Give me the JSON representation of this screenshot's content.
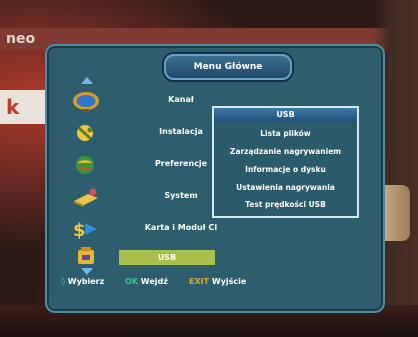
{
  "background": {
    "ticker_text": "neo",
    "side_letter": "k"
  },
  "menu": {
    "title": "Menu Główne",
    "items": [
      {
        "label": "Kanał",
        "icon": "tv-icon"
      },
      {
        "label": "Instalacja",
        "icon": "satellite-dish-icon"
      },
      {
        "label": "Preferencje",
        "icon": "globe-icon"
      },
      {
        "label": "System",
        "icon": "system-icon"
      },
      {
        "label": "Karta i Moduł CI",
        "icon": "card-icon"
      },
      {
        "label": "USB",
        "icon": "usb-icon",
        "selected": true
      }
    ]
  },
  "usb_panel": {
    "title": "USB",
    "items": [
      "Lista plików",
      "Zarządzanie nagrywaniem",
      "Informacje o dysku",
      "Ustawienia nagrywania",
      "Test prędkości USB"
    ]
  },
  "footer": {
    "select_key": "◊",
    "select_label": "Wybierz",
    "ok_key": "OK",
    "ok_label": "Wejdź",
    "exit_key": "EXIT",
    "exit_label": "Wyjście"
  },
  "colors": {
    "menu_bg": "#2e5d6e",
    "selected_bg": "#a9bf4b",
    "accent": "#56b9e8"
  }
}
